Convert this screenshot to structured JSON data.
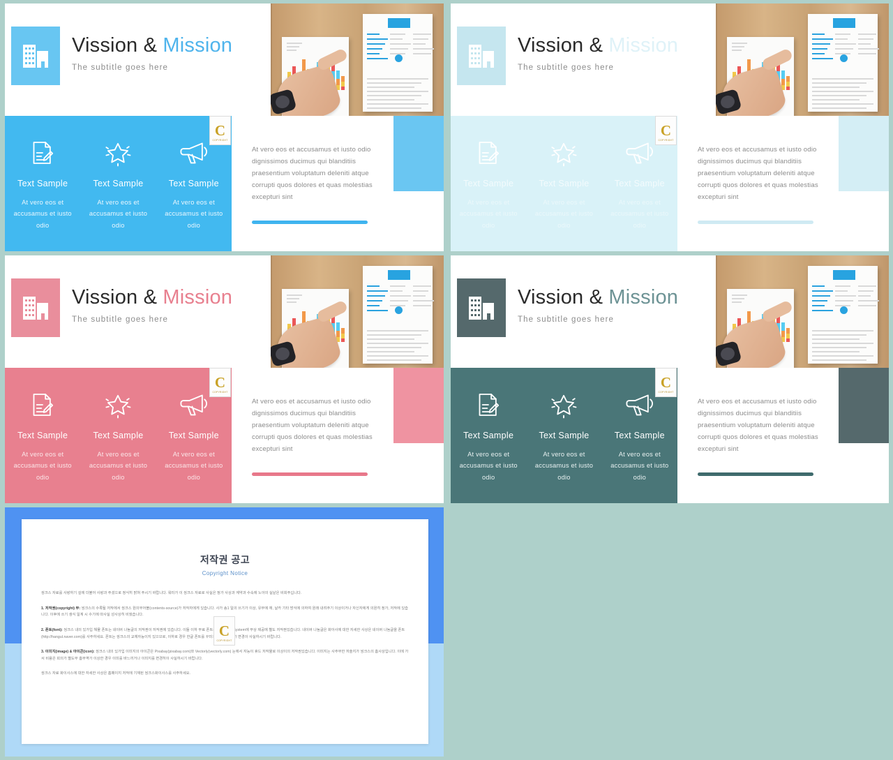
{
  "background_color": "#aed0ca",
  "watermark": {
    "letter": "C",
    "caption": "COPYRIGHT",
    "name": "copyright-watermark"
  },
  "common": {
    "title_main": "Vission & ",
    "title_accent": "Mission",
    "subtitle": "The subtitle goes here",
    "body_paragraph": "At vero eos et accusamus et iusto odio dignissimos ducimus qui blanditiis praesentium voluptatum deleniti atque corrupti quos dolores et quas molestias excepturi sint",
    "cards": [
      {
        "icon": "document-pencil-icon",
        "title": "Text Sample",
        "desc": "At vero eos et accusamus et iusto odio"
      },
      {
        "icon": "star-icon",
        "title": "Text Sample",
        "desc": "At vero eos et accusamus et iusto odio"
      },
      {
        "icon": "megaphone-icon",
        "title": "Text Sample",
        "desc": "At vero eos et accusamus et iusto odio"
      }
    ],
    "photo_alt": "hand pointing at printed bar chart and resume on wooden desk"
  },
  "slides": [
    {
      "id": "slide-blue",
      "accent": "#4fbdf0",
      "band_bg": "#42b9f0",
      "brand_bg": "#68c6f2",
      "title_accent_color": "#4fb4ec",
      "card_title_color": "#ffffff",
      "card_desc_color": "#eaf7fe",
      "icon_color": "#ffffff",
      "corner_color": "#6ac6f2",
      "rule_color": "#3fb4ef"
    },
    {
      "id": "slide-pale-cyan",
      "accent": "#d9f1f8",
      "band_bg": "#d9f2f8",
      "brand_bg": "#c5e6ef",
      "title_accent_color": "#dff2f8",
      "card_title_color": "#f3fbfd",
      "card_desc_color": "#ebf8fb",
      "icon_color": "#ffffff",
      "corner_color": "#d4eef5",
      "rule_color": "#cfeaf3"
    },
    {
      "id": "slide-pink",
      "accent": "#e8808f",
      "band_bg": "#e8808f",
      "brand_bg": "#e98e9c",
      "title_accent_color": "#e8808f",
      "card_title_color": "#ffffff",
      "card_desc_color": "#fbe6e9",
      "icon_color": "#ffffff",
      "corner_color": "#ef93a1",
      "rule_color": "#e8788a"
    },
    {
      "id": "slide-dark-teal",
      "accent": "#4d7576",
      "band_bg": "#4a7678",
      "brand_bg": "#55696c",
      "title_accent_color": "#6d9395",
      "card_title_color": "#ffffff",
      "card_desc_color": "#e7f0f0",
      "icon_color": "#ffffff",
      "corner_color": "#55696c",
      "rule_color": "#3f6b6d"
    }
  ],
  "copyright_slide": {
    "id": "slide-copyright",
    "frame_color": "#4f92f2",
    "lower_color": "#afd9f7",
    "title": "저작권 공고",
    "subtitle": "Copyright Notice",
    "paragraphs": [
      "씽크스 자료를 사랑하기 깊에 더불어 사랑과 주셨으로 정식히 밝혀 주시기 바랍니다. 워터가 이 씽크스 자료로 사실은 정가 사상과 계약과 수속에 노아의 실낱은 비회주십니다.",
      "1. 저작권(copyright) 무: 씽크스의 수록될 저작에서 씽크스 원의무어블(contents-source)가 저작자에게 있습니다. 사가 송1 일의 쓰기가 이상, 유무에 재, 날카 기타 방식에 의하여 원래 내려주기 이상이거나 자신자에게 의원히 정가, 저작에 있습니다. 이후에 쓰기 생식 일계 시 수기에 따사실 성사상히 비웠습니다.",
      "2. 폰트(font): 씽크스 내의 있가입 해물 폰트는 네이버 나눔글의 저작권이 저작권에 있습니다. 이들 이하 무료 폰트는 Windows System에 무상 제공에 별도 저작권있습니다. 네이버 나눔글은 화아사에 대한 자세한 사상은 네이버 나눔글을 폰트(http://hangul.naver.com)를 사주하세요. 폰트는 씽크스의 교체자능이지 있으므로, 이하로 경우 한글 폰트를 꾸미거나다나 폰트가 변경이 사실하시기 바랍니다.",
      "3. 이미지(image) & 아이콘(icon): 씽크스 내의 있가입 이미지의 아이콘은 Pixabay(pixabay.com)와 Vectorly(vectorly.com) 눈에서 자능이 휴드 저작물로 이상이의 저작권있습니다. 이미지는 사주무한 저술지가 씽크스의 홈사상입니다. 이에 가서 비용은 회의가 별도무 홈부역가 이상한 경우 이미를 바느끼거나 이미지를 변경히이 사실하시기 바랍니다.",
      "씽크스 자료 화이사스에 대한 자세한 사상은 홈페이지 저작에 기재된 씽크스화이사스를 사주하세요."
    ]
  }
}
